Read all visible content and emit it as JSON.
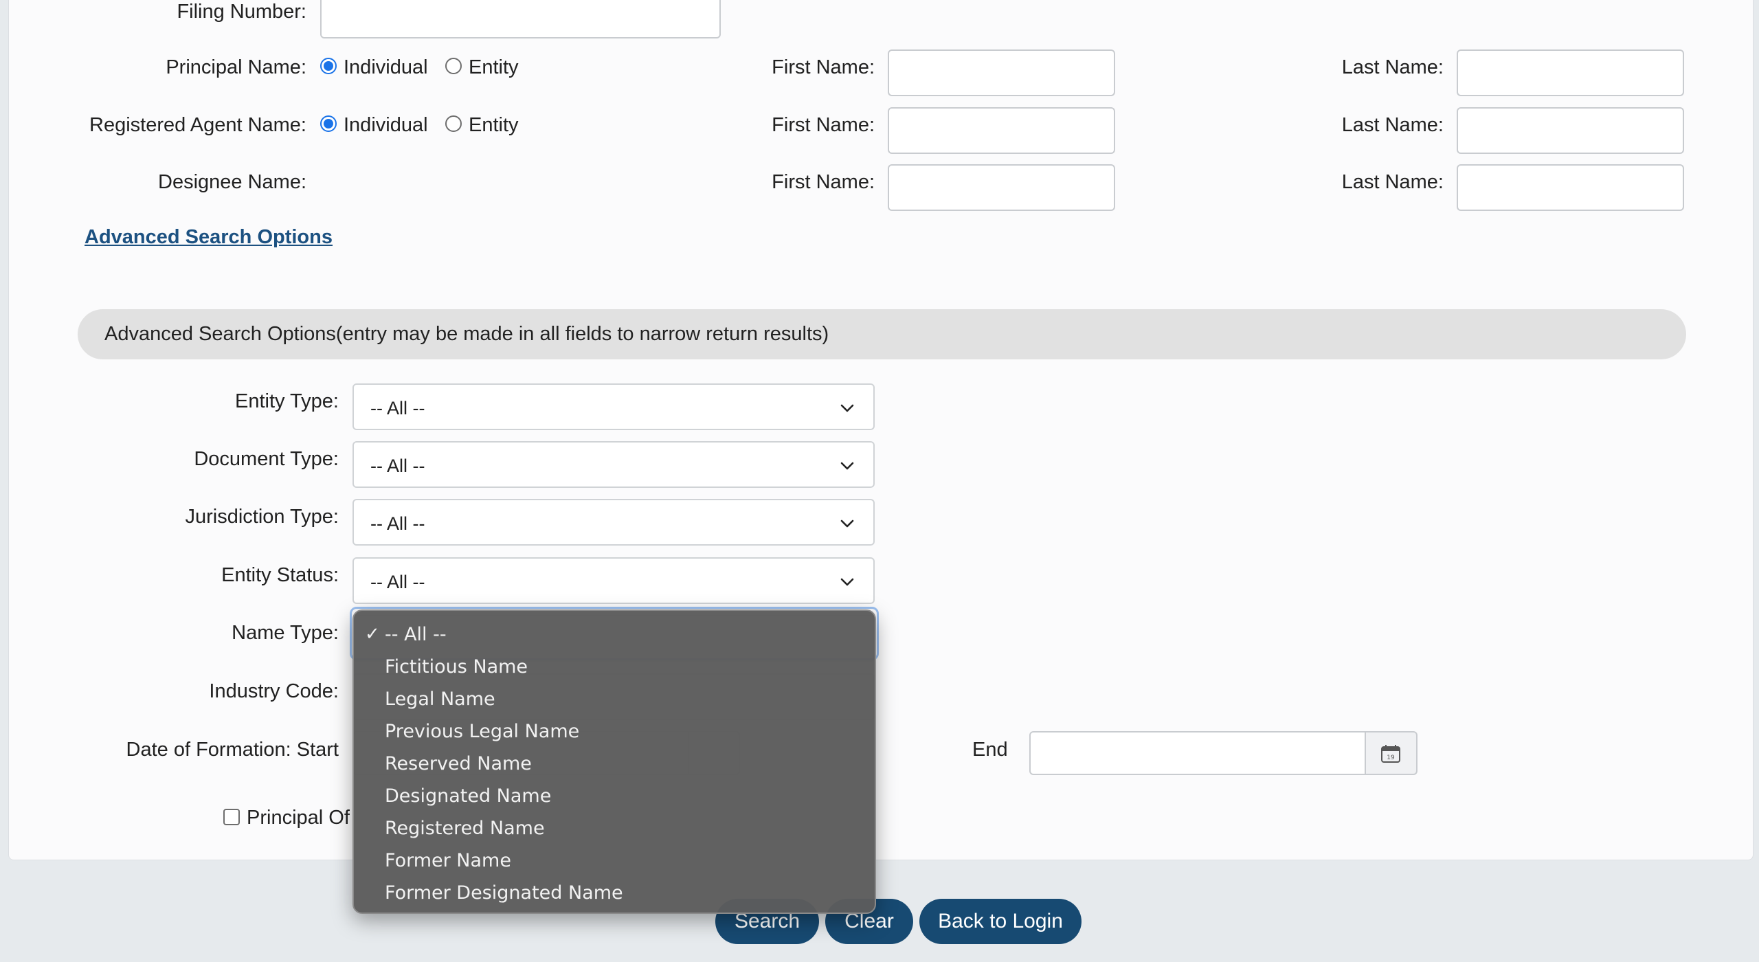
{
  "form": {
    "filing_number_label": "Filing Number:",
    "principal_name_label": "Principal Name:",
    "registered_agent_label": "Registered Agent Name:",
    "designee_name_label": "Designee Name:",
    "individual_label": "Individual",
    "entity_label": "Entity",
    "first_name_label": "First Name:",
    "last_name_label": "Last Name:",
    "advanced_link": "Advanced Search Options"
  },
  "advanced": {
    "section_title": "Advanced Search Options(entry may be made in all fields to narrow return results)",
    "entity_type_label": "Entity Type:",
    "document_type_label": "Document Type:",
    "jurisdiction_type_label": "Jurisdiction Type:",
    "entity_status_label": "Entity Status:",
    "name_type_label": "Name Type:",
    "industry_code_label": "Industry Code:",
    "date_start_label": "Date of Formation: Start",
    "date_end_label": "End",
    "principal_office_label": "Principal Of",
    "entity_type_value": "-- All --",
    "document_type_value": "-- All --",
    "jurisdiction_type_value": "-- All --",
    "entity_status_value": "-- All --",
    "calendar_day": "19"
  },
  "name_type_menu": {
    "checkmark": "✓",
    "options": [
      "-- All --",
      "Fictitious Name",
      "Legal Name",
      "Previous Legal Name",
      "Reserved Name",
      "Designated Name",
      "Registered Name",
      "Former Name",
      "Former Designated Name"
    ],
    "selected_index": 0
  },
  "buttons": {
    "search": "Search",
    "clear": "Clear",
    "back_to_login": "Back to Login"
  },
  "colors": {
    "button_bg": "#174a72",
    "link": "#1c5181",
    "radio_selected": "#1a73e8"
  }
}
